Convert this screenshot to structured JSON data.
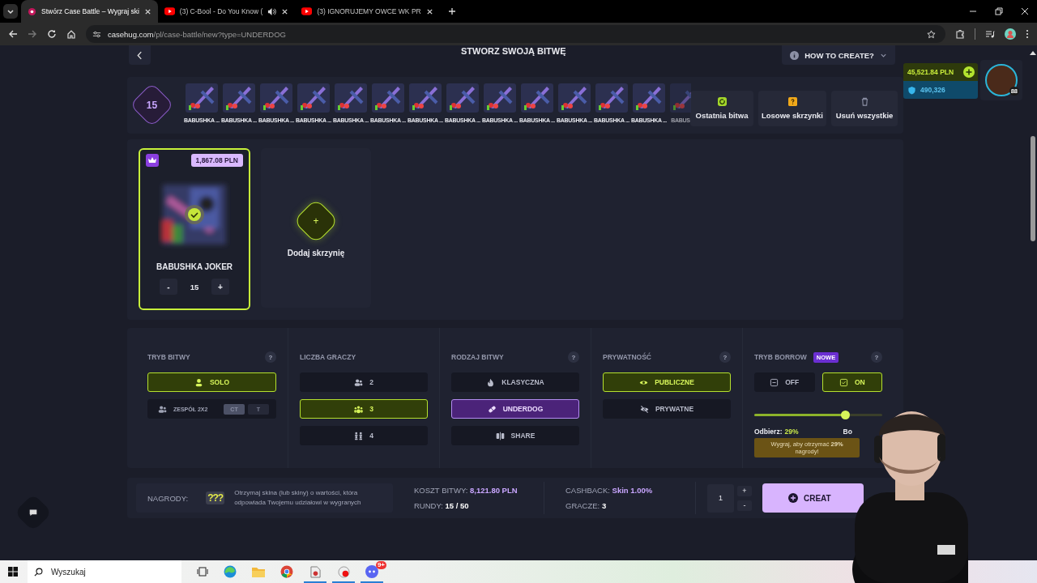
{
  "browser": {
    "tabs": [
      {
        "title": "Stwórz Case Battle – Wygraj ski",
        "selected": true,
        "kind": "site",
        "audio": false
      },
      {
        "title": "(3) C-Bool - Do You Know (",
        "selected": false,
        "kind": "video",
        "audio": true
      },
      {
        "title": "(3) IGNORUJEMY OWCE WK PR",
        "selected": false,
        "kind": "video",
        "audio": false
      }
    ],
    "url_host": "casehug.com",
    "url_path": "/pl/case-battle/new?type=UNDERDOG"
  },
  "header": {
    "title": "STWORZ SWOJĄ BITWĘ",
    "help": "HOW TO CREATE?"
  },
  "account": {
    "balance": "45,521.84 PLN",
    "coins": "490,326",
    "level": "88"
  },
  "case_strip": {
    "count": "15",
    "cases": [
      "BABUSHKA ...",
      "BABUSHKA ...",
      "BABUSHKA ...",
      "BABUSHKA ...",
      "BABUSHKA ...",
      "BABUSHKA ...",
      "BABUSHKA ...",
      "BABUSHKA ...",
      "BABUSHKA ...",
      "BABUSHKA ...",
      "BABUSHKA ...",
      "BABUSHKA ...",
      "BABUSHKA ...",
      "BABUS"
    ],
    "actions": [
      {
        "label": "Ostatnia bitwa",
        "kind": "history"
      },
      {
        "label": "Losowe skrzynki",
        "kind": "random"
      },
      {
        "label": "Usuń wszystkie",
        "kind": "trash"
      }
    ]
  },
  "selected_cases": [
    {
      "price": "1,867.08 PLN",
      "name": "BABUSHKA JOKER",
      "quantity": "15",
      "minus": "-",
      "plus": "+"
    }
  ],
  "add_case": {
    "icon": "+",
    "label": "Dodaj skrzynię"
  },
  "settings": {
    "columns": [
      {
        "kind": "mode",
        "title": "TRYB BITWY",
        "help": "?",
        "options": [
          {
            "label": "SOLO",
            "selected": true
          },
          {
            "label": "ZESPÓŁ 2X2",
            "selected": false,
            "sides": [
              {
                "label": "CT",
                "selected": true
              },
              {
                "label": "T",
                "selected": false
              }
            ]
          }
        ]
      },
      {
        "kind": "players",
        "title": "LICZBA GRACZY",
        "options": [
          {
            "label": "2",
            "selected": false
          },
          {
            "label": "3",
            "selected": true
          },
          {
            "label": "4",
            "selected": false
          }
        ]
      },
      {
        "kind": "type",
        "title": "RODZAJ BITWY",
        "help": "?",
        "options": [
          {
            "label": "KLASYCZNA",
            "selected": false
          },
          {
            "label": "UNDERDOG",
            "selected": true
          },
          {
            "label": "SHARE",
            "selected": false
          }
        ]
      },
      {
        "kind": "privacy",
        "title": "PRYWATNOŚĆ",
        "help": "?",
        "options": [
          {
            "label": "PUBLICZNE",
            "selected": true
          },
          {
            "label": "PRYWATNE",
            "selected": false
          }
        ]
      },
      {
        "kind": "borrow",
        "title": "TRYB BORROW",
        "badge": "NOWE",
        "help": "?",
        "options": [
          {
            "label": "OFF",
            "selected": false
          },
          {
            "label": "ON",
            "selected": true
          }
        ],
        "level": 0.71,
        "receive_label": "Odbierz:",
        "receive_value": "29%",
        "borrow_label": "Bo",
        "tooltip": "Wygraj, aby otrzymać **29%**\nnagrody!"
      }
    ]
  },
  "summary": {
    "rewards_label": "NAGRODY:",
    "rewards_icon": "???",
    "rewards_text": "Otrzymaj skina (lub skiny) o wartości, która odpowiada Twojemu udziałowi w wygranych",
    "cost_label": "KOSZT BITWY:",
    "cost": "8,121.80 PLN",
    "rounds_label": "RUNDY:",
    "rounds": "15 / 50",
    "cashback_label": "CASHBACK:",
    "cashback": "Skin 1.00%",
    "players_label": "GRACZE:",
    "players": "3",
    "quantity": "1",
    "plus": "+",
    "minus": "-",
    "create": "CREAT"
  },
  "taskbar": {
    "search": "Wyszukaj",
    "badge": "9+"
  }
}
